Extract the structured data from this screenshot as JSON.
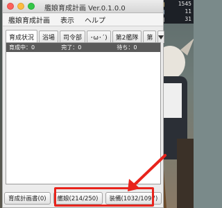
{
  "window": {
    "title": "艦娘育成計画 Ver.0.1.0.0"
  },
  "menu": [
    "艦娘育成計画",
    "表示",
    "ヘルプ"
  ],
  "tabs": [
    "育成状況",
    "浴場",
    "司令部",
    "･ω･´)",
    "第2艦隊",
    "第"
  ],
  "list_header": {
    "training": "育成中：0",
    "done": "完了：0",
    "waiting": "待ち：0"
  },
  "buttons": {
    "plan_doc": "育成計画書(0)",
    "ship_girls": "艦娘(214/250)",
    "equipment": "装備(1032/1097)"
  },
  "hud": {
    "lines": [
      "1545",
      "11",
      "31"
    ]
  },
  "colors": {
    "highlight": "#e8241c",
    "list_header_bg": "#5a5a5a"
  }
}
